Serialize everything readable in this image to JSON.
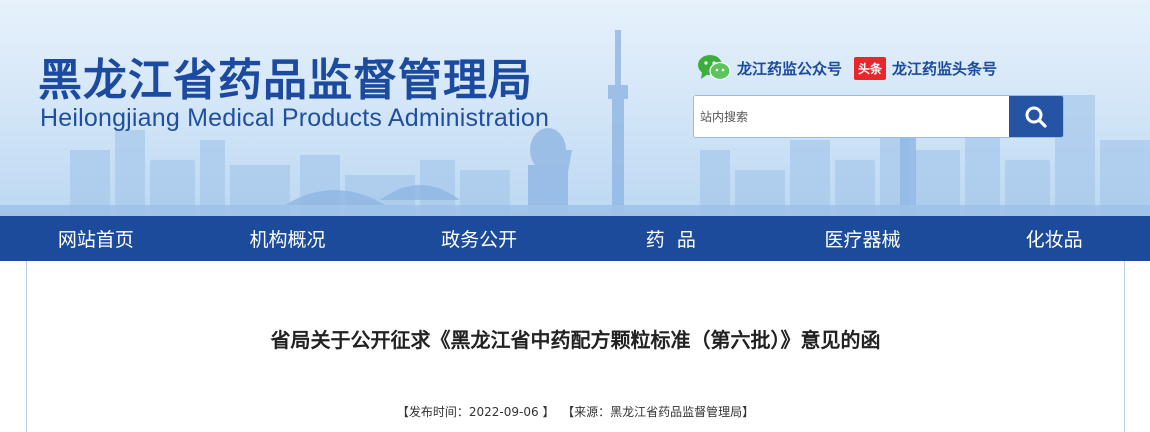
{
  "header": {
    "title_cn": "黑龙江省药品监督管理局",
    "title_en": "Heilongjiang Medical Products Administration",
    "wechat_label": "龙江药监公众号",
    "toutiao_badge": "头条",
    "toutiao_label": "龙江药监头条号",
    "search": {
      "placeholder": "站内搜索"
    },
    "colors": {
      "brand_blue": "#1d4b9b",
      "search_button": "#2654a5",
      "toutiao_red": "#e8262b",
      "wechat_green": "#3dae3d"
    }
  },
  "nav": {
    "items": [
      "网站首页",
      "机构概况",
      "政务公开",
      "药  品",
      "医疗器械",
      "化妆品"
    ]
  },
  "article": {
    "title": "省局关于公开征求《黑龙江省中药配方颗粒标准（第六批）》意见的函",
    "publish_label": "【发布时间：",
    "publish_date": "2022-09-06",
    "publish_close": " 】",
    "source_label": "【来源：",
    "source": "黑龙江省药品监督管理局",
    "source_close": "】"
  },
  "icons": [
    "wechat-icon",
    "search-icon"
  ]
}
